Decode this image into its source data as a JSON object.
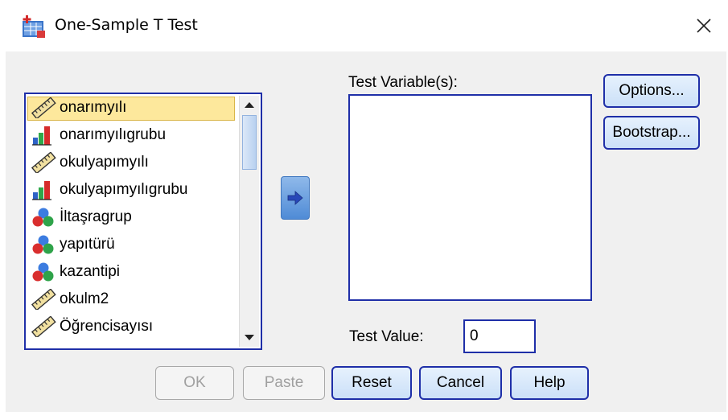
{
  "window": {
    "title": "One-Sample T Test"
  },
  "variables": [
    {
      "label": "onarımyılı",
      "icon": "ruler-icon",
      "selected": true
    },
    {
      "label": "onarımyılıgrubu",
      "icon": "bar-chart-icon",
      "selected": false
    },
    {
      "label": "okulyapımyılı",
      "icon": "ruler-icon",
      "selected": false
    },
    {
      "label": "okulyapımyılıgrubu",
      "icon": "bar-chart-icon",
      "selected": false
    },
    {
      "label": "İltaşragrup",
      "icon": "nominal-circles-icon",
      "selected": false
    },
    {
      "label": "yapıtürü",
      "icon": "nominal-circles-icon",
      "selected": false
    },
    {
      "label": "kazantipi",
      "icon": "nominal-circles-icon",
      "selected": false
    },
    {
      "label": "okulm2",
      "icon": "ruler-icon",
      "selected": false
    },
    {
      "label": "Öğrencisayısı",
      "icon": "ruler-icon",
      "selected": false
    }
  ],
  "test_variables": {
    "label": "Test Variable(s):",
    "items": []
  },
  "test_value": {
    "label": "Test Value:",
    "value": "0"
  },
  "side_buttons": {
    "options": "Options...",
    "bootstrap": "Bootstrap..."
  },
  "footer_buttons": {
    "ok": "OK",
    "paste": "Paste",
    "reset": "Reset",
    "cancel": "Cancel",
    "help": "Help"
  },
  "colors": {
    "accent_border": "#1f2fa8",
    "selection": "#fde89c",
    "button_face": "#dbe9fb"
  }
}
